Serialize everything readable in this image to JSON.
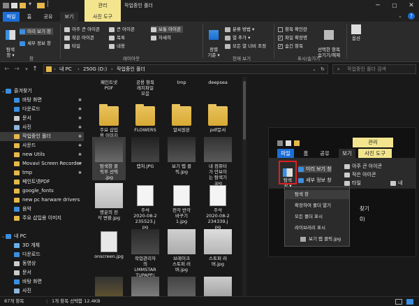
{
  "window": {
    "manage_tab": "관리",
    "title": "작업중인 폴더",
    "min": "─",
    "max": "☐",
    "close": "✕",
    "help": "?"
  },
  "ribbon_tabs": {
    "file": "파일",
    "home": "홈",
    "share": "공유",
    "view": "보기",
    "picture_tools": "사진 도구"
  },
  "ribbon": {
    "pane": {
      "nav_pane": "탐색\n창 ▾",
      "preview_pane": "미리 보기 창",
      "details_pane": "세부 정보 창",
      "label": "창"
    },
    "layout": {
      "items": [
        "아주 큰 아이콘",
        "큰 아이콘",
        "보통 아이콘",
        "작은 아이콘",
        "목록",
        "자세히",
        "타일",
        "내용"
      ],
      "label": "레이아웃"
    },
    "current_view": {
      "sort": "정렬\n기준 ▾",
      "group": "분류 방법 ▾",
      "add_column": "열 추가 ▾",
      "fit_columns": "모든 열 너비 조정",
      "label": "현재 보기"
    },
    "show_hide": {
      "item_checkbox": "항목 확인란",
      "extensions": "파일 확장명",
      "hidden_items": "숨긴 항목",
      "hide_selected": "선택한 항목\n숨기기/해제",
      "label": "표시/숨기기"
    },
    "options": {
      "label": "옵션"
    }
  },
  "address": {
    "back": "←",
    "forward": "→",
    "history": "▾",
    "up": "↑",
    "crumbs": [
      "내 PC",
      "250G (D:)",
      "작업중인 폴더"
    ],
    "refresh": "↻",
    "search_placeholder": "작업중인 폴더 검색"
  },
  "sidebar": {
    "quick_access": "즐겨찾기",
    "items": [
      "바탕 화면",
      "다운로드",
      "문서",
      "사진",
      "작업중인 폴더",
      "사운드",
      "new Utils",
      "Movavi Screen Recorder",
      "tmp",
      "페인트넷PDF",
      "google_fonts",
      "new pc harware drivers",
      "음악",
      "주요 삽입용 이미지"
    ],
    "this_pc": "내 PC",
    "pc_items": [
      "3D 개체",
      "다운로드",
      "동영상",
      "문서",
      "바탕 화면",
      "사진"
    ]
  },
  "grid": {
    "rows": [
      [
        "페인트넷\nPDF",
        "공용 항목\n레지파일\n모음",
        "tmp",
        "deepsea"
      ],
      [
        "주요 삽입\n용 이미지",
        "FLOWERS",
        "알씨원본",
        "pdf문서"
      ],
      [
        "탐색창 클\n릭후 선택\n.jpg",
        "캡처.JPG",
        "보기 탭 클\n릭.jpg",
        "내 컴퓨터\n가 안보이\n는 탐색기\n.jpg"
      ],
      [
        "명운의 전\n각 변환.jpg",
        "주석\n2020-08-2\n235523.j\npg",
        "전각 반각\n바꾸기\n1.jpg",
        "주석\n2020-08-2\n234339.j\npg"
      ],
      [
        "onscreen.jpg",
        "작업관리자\n의\nLMMSTAR\nTUPAPP.j",
        "브레이크\n스토퍼 러\n버.jpg",
        "스토퍼 러\n버.jpg"
      ]
    ]
  },
  "inset": {
    "manage": "관리",
    "file": "파일",
    "home": "홈",
    "share": "공유",
    "view": "보기",
    "picture": "사진 도구",
    "nav_pane": "탐색\n창 ▾",
    "preview": "미리 보기 창",
    "details": "세부 정보 창",
    "large_icons": "아주 큰 아이콘",
    "small_icons": "작은 아이콘",
    "tiles": "타일",
    "list": "내",
    "menu": [
      "탐색 창",
      "확장하여 폴더 열기",
      "모든 폴더 표시",
      "라이브러리 표시"
    ],
    "bg_text1": "찾기",
    "bg_text2": "0)",
    "file_label": "보기 탭 클릭.jpg"
  },
  "status": {
    "count": "87개 항목",
    "selected": "1개 항목 선택함 12.4KB"
  }
}
